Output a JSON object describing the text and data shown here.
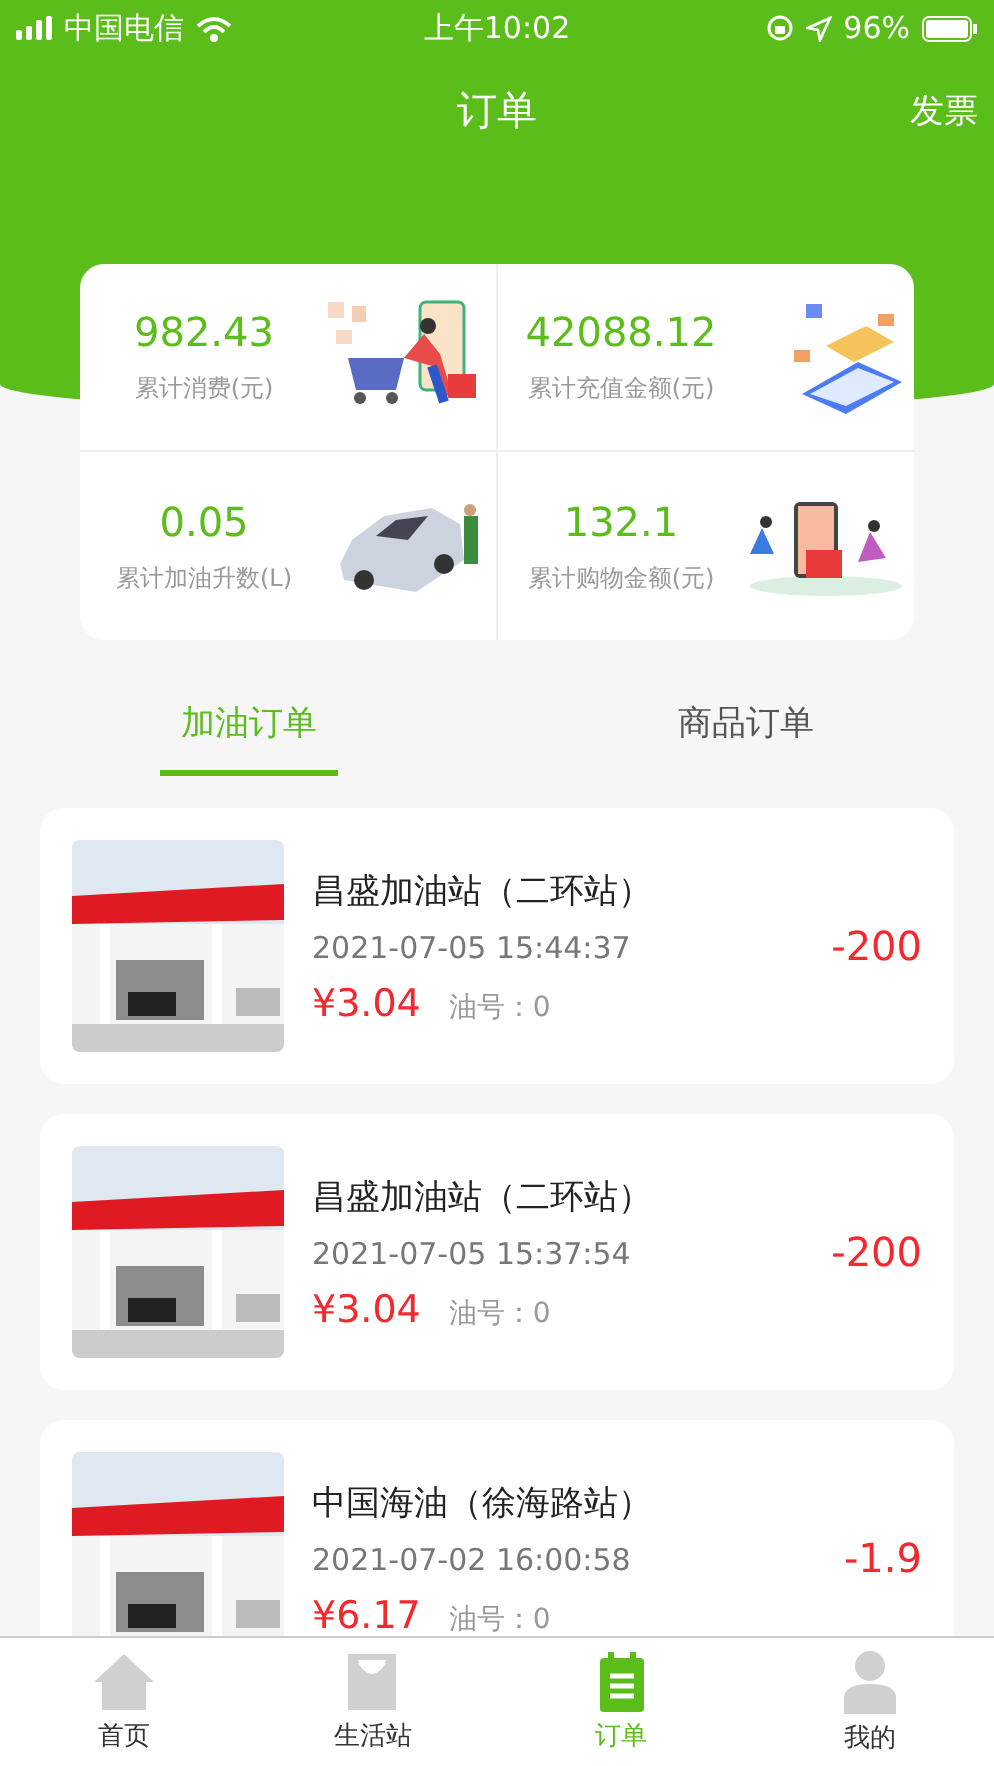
{
  "status_bar": {
    "carrier": "中国电信",
    "time": "上午10:02",
    "battery": "96%"
  },
  "nav": {
    "title": "订单",
    "action": "发票"
  },
  "stats": [
    {
      "value": "982.43",
      "label": "累计消费(元)",
      "kind": "shopping"
    },
    {
      "value": "42088.12",
      "label": "累计充值金额(元)",
      "kind": "recharge"
    },
    {
      "value": "0.05",
      "label": "累计加油升数(L)",
      "kind": "car"
    },
    {
      "value": "132.1",
      "label": "累计购物金额(元)",
      "kind": "gift"
    }
  ],
  "tabs": [
    {
      "label": "加油订单",
      "selected": true
    },
    {
      "label": "商品订单",
      "selected": false
    }
  ],
  "orders": [
    {
      "station": "昌盛加油站（二环站）",
      "time": "2021-07-05 15:44:37",
      "price": "¥3.04",
      "fuel": "油号：0",
      "amount": "-200"
    },
    {
      "station": "昌盛加油站（二环站）",
      "time": "2021-07-05 15:37:54",
      "price": "¥3.04",
      "fuel": "油号：0",
      "amount": "-200"
    },
    {
      "station": "中国海油（徐海路站）",
      "time": "2021-07-02 16:00:58",
      "price": "¥6.17",
      "fuel": "油号：0",
      "amount": "-1.9"
    }
  ],
  "tab_bar": [
    {
      "label": "首页",
      "kind": "home",
      "selected": false
    },
    {
      "label": "生活站",
      "kind": "bag",
      "selected": false
    },
    {
      "label": "订单",
      "kind": "orders",
      "selected": true
    },
    {
      "label": "我的",
      "kind": "user",
      "selected": false
    }
  ]
}
